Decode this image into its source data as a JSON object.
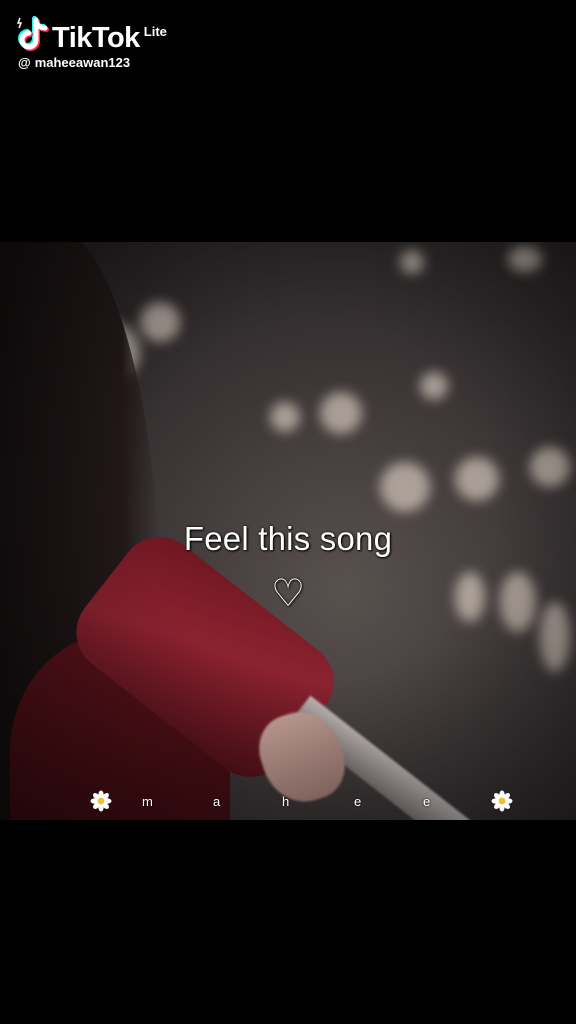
{
  "watermark": {
    "brand": "TikTok",
    "badge": "Lite",
    "at_symbol": "@",
    "handle": "maheeawan123"
  },
  "overlay": {
    "caption": "Feel this song",
    "heart": "♡",
    "signature_letters": [
      "m",
      "a",
      "h",
      "e",
      "e"
    ]
  },
  "icons": {
    "logo": "tiktok-note-icon",
    "signature_flower": "daisy-icon"
  },
  "colors": {
    "text": "#ffffff",
    "sleeve_red": "#8c2230",
    "tiktok_cyan": "#25f4ee",
    "tiktok_pink": "#fe2c55"
  }
}
